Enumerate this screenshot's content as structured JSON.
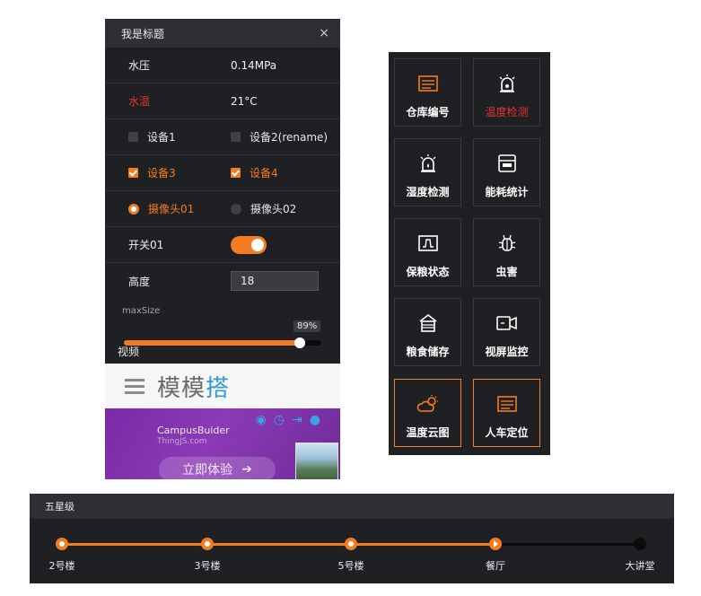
{
  "panel": {
    "title": "我是标题",
    "close_glyph": "×",
    "water_pressure_label": "水压",
    "water_pressure_value": "0.14MPa",
    "water_temp_label": "水温",
    "water_temp_value": "21°C",
    "checkbox_1": "设备1",
    "checkbox_2": "设备2(rename)",
    "checkbox_3": "设备3",
    "checkbox_4": "设备4",
    "radio_1": "摄像头01",
    "radio_2": "摄像头02",
    "switch_label": "开关01",
    "switch_on": true,
    "height_label": "高度",
    "height_value": "18",
    "slider_label": "maxSize",
    "slider_value_text": "89%",
    "slider_value": 0.89,
    "video_label": "视频",
    "video_logo_main": "模模",
    "video_logo_accent": "搭",
    "promo_title": "CampusBuider",
    "promo_sub": "ThingJS.com",
    "promo_button": "立即体验"
  },
  "tiles": [
    {
      "label": "仓库编号",
      "icon": "warehouse-number-icon",
      "active": true,
      "red": false
    },
    {
      "label": "温度检测",
      "icon": "temperature-alarm-icon",
      "active": false,
      "red": true
    },
    {
      "label": "湿度检测",
      "icon": "humidity-alarm-icon",
      "active": false,
      "red": false
    },
    {
      "label": "能耗统计",
      "icon": "energy-meter-icon",
      "active": false,
      "red": false
    },
    {
      "label": "保粮状态",
      "icon": "grain-status-icon",
      "active": false,
      "red": false
    },
    {
      "label": "虫害",
      "icon": "bug-icon",
      "active": false,
      "red": false
    },
    {
      "label": "粮食储存",
      "icon": "grain-storage-icon",
      "active": false,
      "red": false
    },
    {
      "label": "视屏监控",
      "icon": "camera-monitor-icon",
      "active": false,
      "red": false
    },
    {
      "label": "温度云图",
      "icon": "weather-cloud-icon",
      "active": true,
      "red": false
    },
    {
      "label": "人车定位",
      "icon": "person-vehicle-icon",
      "active": true,
      "red": false
    }
  ],
  "stars": {
    "title": "五星级",
    "steps": [
      "2号楼",
      "3号楼",
      "5号楼",
      "餐厅",
      "大讲堂"
    ],
    "current_index": 3
  },
  "colors": {
    "accent": "#f47c20",
    "alert": "#e8332d",
    "panel_bg": "#1f2024",
    "header_bg": "#2d2f35"
  }
}
